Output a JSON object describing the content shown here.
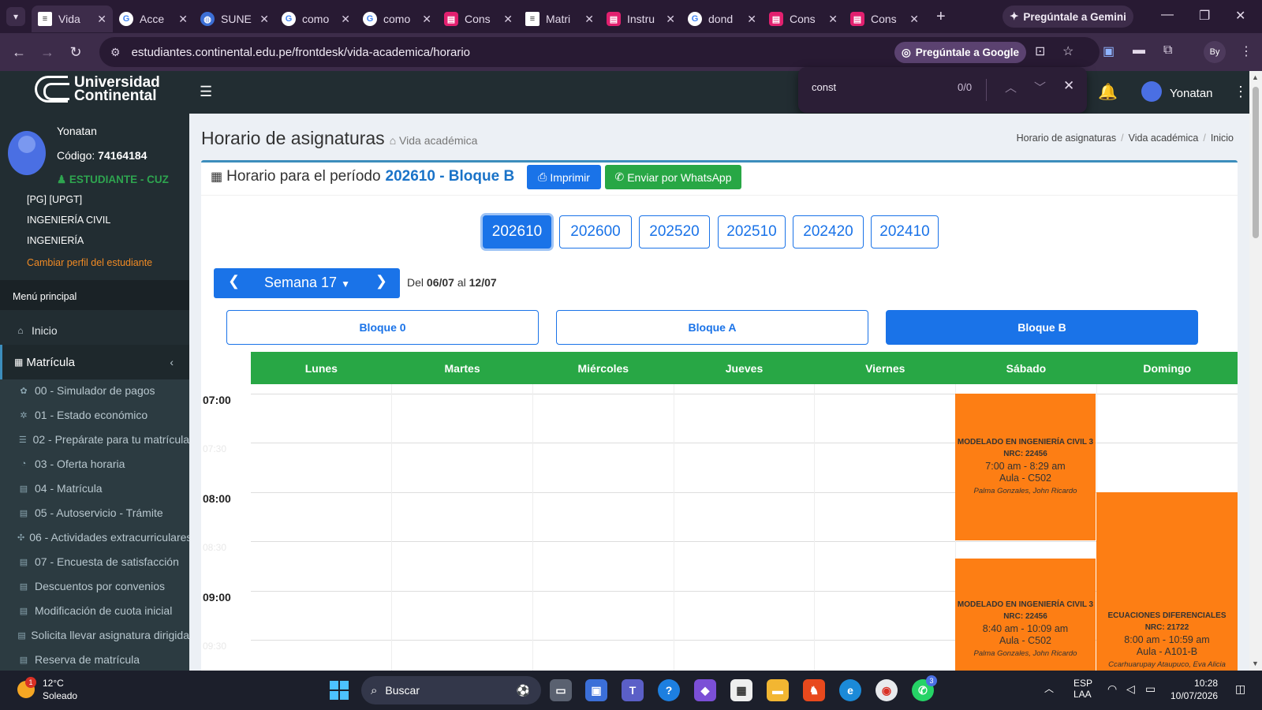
{
  "browser": {
    "tabs": [
      {
        "label": "Vida",
        "icon": "doc-icon",
        "active": true
      },
      {
        "label": "Acce",
        "icon": "google-icon"
      },
      {
        "label": "SUNE",
        "icon": "globe-icon"
      },
      {
        "label": "como",
        "icon": "google-icon"
      },
      {
        "label": "como",
        "icon": "google-icon"
      },
      {
        "label": "Cons",
        "icon": "pink-app-icon"
      },
      {
        "label": "Matri",
        "icon": "doc-icon"
      },
      {
        "label": "Instru",
        "icon": "pink-app-icon"
      },
      {
        "label": "dond",
        "icon": "google-icon"
      },
      {
        "label": "Cons",
        "icon": "pink-app-icon"
      },
      {
        "label": "Cons",
        "icon": "pink-app-icon"
      }
    ],
    "gemini_label": "Pregúntale a Gemini",
    "url": "estudiantes.continental.edu.pe/frontdesk/vida-academica/horario",
    "ask_google_label": "Pregúntale a Google",
    "profile_initials": "By",
    "find": {
      "query": "const",
      "count": "0/0"
    }
  },
  "header": {
    "logo_line1": "Universidad",
    "logo_line2": "Continental",
    "user_name": "Yonatan"
  },
  "sidebar": {
    "name": "Yonatan",
    "code_label": "Código:",
    "code": "74164184",
    "role": "ESTUDIANTE - CUZ",
    "program": "[PG] [UPGT]",
    "career": "INGENIERÍA CIVIL",
    "faculty": "INGENIERÍA",
    "change_profile": "Cambiar perfil del estudiante",
    "menu_header": "Menú principal",
    "home": "Inicio",
    "matricula": "Matrícula",
    "subitems": [
      {
        "label": "00 - Simulador de pagos",
        "icon": "calculator-icon"
      },
      {
        "label": "01 - Estado económico",
        "icon": "money-icon"
      },
      {
        "label": "02 - Prepárate para tu matrícula",
        "icon": "list-icon"
      },
      {
        "label": "03 - Oferta horaria",
        "icon": "clock-icon"
      },
      {
        "label": "04 - Matrícula",
        "icon": "file-icon"
      },
      {
        "label": "05 - Autoservicio - Trámite",
        "icon": "file-icon"
      },
      {
        "label": "06 - Actividades extracurriculares",
        "icon": "users-icon"
      },
      {
        "label": "07 - Encuesta de satisfacción",
        "icon": "file-icon"
      },
      {
        "label": "Descuentos por convenios",
        "icon": "file-icon"
      },
      {
        "label": "Modificación de cuota inicial",
        "icon": "file-icon"
      },
      {
        "label": "Solicita llevar asignatura dirigida",
        "icon": "file-icon"
      },
      {
        "label": "Reserva de matrícula",
        "icon": "file-icon"
      }
    ]
  },
  "page": {
    "title": "Horario de asignaturas",
    "subtitle": "Vida académica",
    "breadcrumb": [
      "Horario de asignaturas",
      "Vida académica",
      "Inicio"
    ],
    "period_prefix": "Horario para el período",
    "period_value": "202610 - Bloque B",
    "print_label": "Imprimir",
    "whatsapp_label": "Enviar por WhatsApp",
    "periods": [
      "202610",
      "202600",
      "202520",
      "202510",
      "202420",
      "202410"
    ],
    "active_period": "202610",
    "week_label": "Semana 17",
    "range_prefix": "Del",
    "range_from": "06/07",
    "range_mid": "al",
    "range_to": "12/07",
    "blocks": [
      "Bloque 0",
      "Bloque A",
      "Bloque B"
    ],
    "active_block": "Bloque B",
    "days": [
      "Lunes",
      "Martes",
      "Miércoles",
      "Jueves",
      "Viernes",
      "Sábado",
      "Domingo"
    ],
    "hours": [
      "07:00",
      "08:00",
      "09:00"
    ],
    "half_hours": [
      "07:30",
      "08:30",
      "09:30"
    ],
    "events": [
      {
        "course": "MODELADO EN INGENIERÍA CIVIL 3",
        "nrc": "NRC: 22456",
        "time": "7:00 am - 8:29 am",
        "room": "Aula - C502",
        "teacher": "Palma Gonzales, John Ricardo",
        "day": "Sábado"
      },
      {
        "course": "MODELADO EN INGENIERÍA CIVIL 3",
        "nrc": "NRC: 22456",
        "time": "8:40 am - 10:09 am",
        "room": "Aula - C502",
        "teacher": "Palma Gonzales, John Ricardo",
        "day": "Sábado"
      },
      {
        "course": "ECUACIONES DIFERENCIALES",
        "nrc": "NRC: 21722",
        "time": "8:00 am - 10:59 am",
        "room": "Aula - A101-B",
        "teacher": "Ccarhuarupay Ataupuco, Eva Alicia",
        "day": "Domingo"
      }
    ]
  },
  "taskbar": {
    "temp": "12°C",
    "weather": "Soleado",
    "weather_badge": "1",
    "search": "Buscar",
    "lang1": "ESP",
    "lang2": "LAA",
    "time": "10:28",
    "date": "10/07/2026",
    "whatsapp_badge": "3"
  },
  "colors": {
    "accent": "#1a73e8",
    "green": "#28a745",
    "orange": "#fd7e14",
    "sidebar": "#222d32"
  }
}
